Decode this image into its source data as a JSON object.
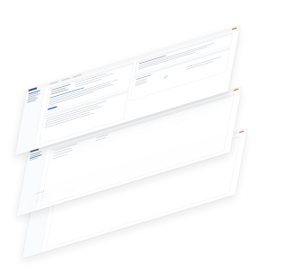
{
  "screens": [
    {
      "id": "front",
      "content": "dashboard"
    },
    {
      "id": "middle",
      "content": "table"
    },
    {
      "id": "back",
      "content": "table"
    }
  ],
  "colors": {
    "accent": "#3a7bd5",
    "brand": "#e8702a",
    "success": "#2ab5a0",
    "text_placeholder": "#cdd2d9"
  },
  "icons": {
    "success": "check-icon"
  }
}
